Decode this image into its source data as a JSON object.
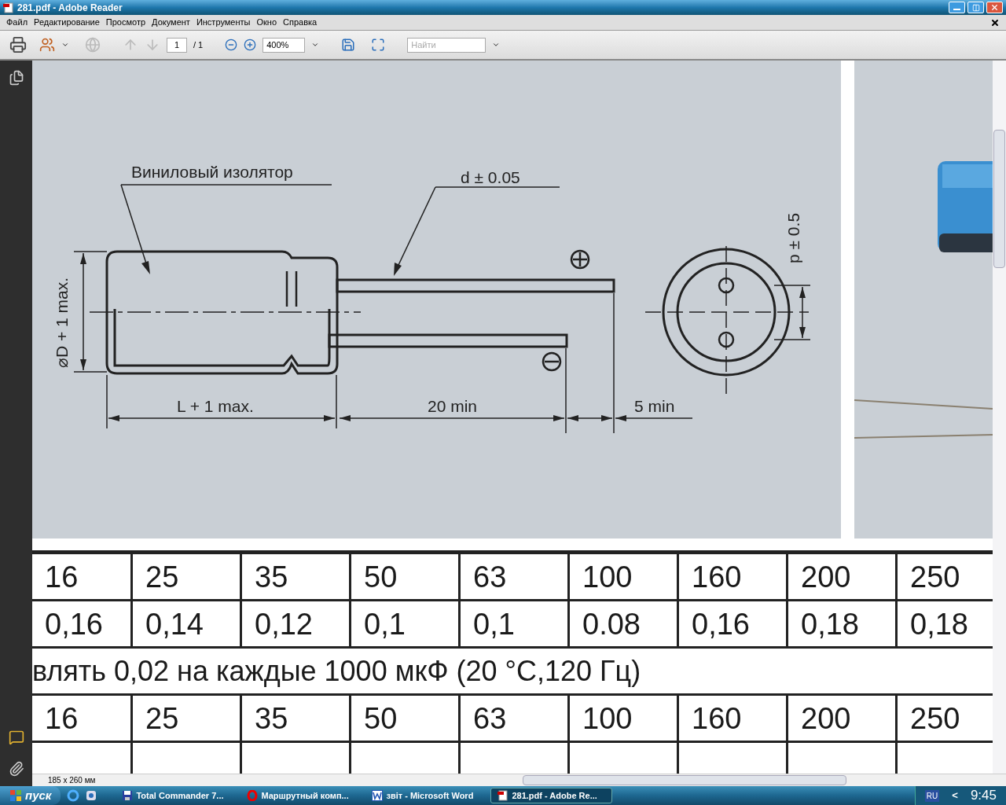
{
  "window": {
    "title": "281.pdf - Adobe Reader"
  },
  "menu": [
    {
      "label": "Файл"
    },
    {
      "label": "Редактирование"
    },
    {
      "label": "Просмотр"
    },
    {
      "label": "Документ"
    },
    {
      "label": "Инструменты"
    },
    {
      "label": "Окно"
    },
    {
      "label": "Справка"
    }
  ],
  "toolbar": {
    "page": "1",
    "page_total": "/ 1",
    "zoom": "400%",
    "search_placeholder": "Найти"
  },
  "drawing": {
    "insulator_label": "Виниловый изолятор",
    "lead_label": "d ± 0.05",
    "diameter_label": "⌀D + 1 max.",
    "length_label": "L + 1 max.",
    "lead_length_label": "20 min",
    "gap_label": "5 min",
    "pitch_label": "p ± 0.5"
  },
  "table": {
    "rows": [
      {
        "kind": "cells",
        "cells": [
          "16",
          "25",
          "35",
          "50",
          "63",
          "100",
          "160",
          "200",
          "250"
        ]
      },
      {
        "kind": "cells",
        "cells": [
          "0,16",
          "0,14",
          "0,12",
          "0,1",
          "0,1",
          "0.08",
          "0,16",
          "0,18",
          "0,18"
        ]
      },
      {
        "kind": "note",
        "text": "влять 0,02 на каждые 1000 мкФ (20 °C,120 Гц)"
      },
      {
        "kind": "cells",
        "cells": [
          "16",
          "25",
          "35",
          "50",
          "63",
          "100",
          "160",
          "200",
          "250"
        ]
      }
    ]
  },
  "status": {
    "page_size": "185 x 260 мм"
  },
  "taskbar": {
    "start": "пуск",
    "tasks": [
      {
        "label": "Total Commander 7...",
        "kind": "disk",
        "selected": false
      },
      {
        "label": "Маршрутный комп...",
        "kind": "opera",
        "selected": false
      },
      {
        "label": "звіт - Microsoft Word",
        "kind": "word",
        "selected": false
      },
      {
        "label": "281.pdf - Adobe Re...",
        "kind": "pdf",
        "selected": true
      }
    ],
    "language": "RU",
    "tray_toggle": "<",
    "clock": "9:45"
  }
}
